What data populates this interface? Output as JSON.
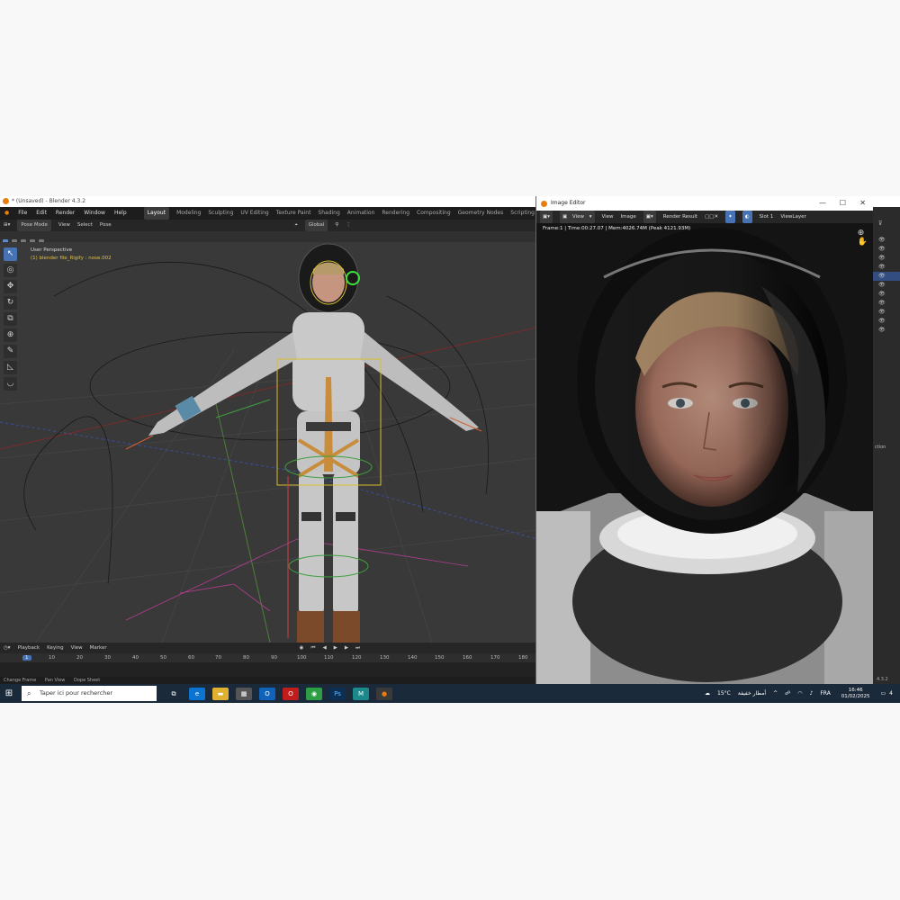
{
  "blender": {
    "title": "* (Unsaved) - Blender 4.3.2",
    "menu": [
      "File",
      "Edit",
      "Render",
      "Window",
      "Help"
    ],
    "workspaces": [
      "Layout",
      "Modeling",
      "Sculpting",
      "UV Editing",
      "Texture Paint",
      "Shading",
      "Animation",
      "Rendering",
      "Compositing",
      "Geometry Nodes",
      "Scripting"
    ],
    "active_workspace": "Layout",
    "header": {
      "mode": "Pose Mode",
      "items": [
        "View",
        "Select",
        "Pose"
      ],
      "orientation": "Global"
    },
    "viewport": {
      "perspective": "User Perspective",
      "active_object": "(1) blender file_Rigify : nose.002"
    },
    "toolbar_icons": [
      "select-box-icon",
      "cursor-icon",
      "move-icon",
      "rotate-icon",
      "scale-icon",
      "transform-icon",
      "annotate-icon",
      "measure-icon",
      "relax-icon"
    ],
    "timeline": {
      "menu": [
        "Playback",
        "Keying",
        "View",
        "Marker"
      ],
      "current_frame": "1",
      "frame_ticks": [
        "10",
        "20",
        "30",
        "40",
        "50",
        "60",
        "70",
        "80",
        "90",
        "100",
        "110",
        "120",
        "130",
        "140",
        "150",
        "160",
        "170",
        "180"
      ]
    },
    "status_bar": [
      "Change Frame",
      "Pan View",
      "Dope Sheet"
    ],
    "version": "4.3.2"
  },
  "image_editor": {
    "title": "Image Editor",
    "header": {
      "view": "View",
      "view2": "View",
      "image": "Image",
      "image_name": "Render Result",
      "slot": "Slot 1",
      "view_layer": "ViewLayer"
    },
    "frame_info": "Frame:1 | Time:00:27.07 | Mem:4026.74M (Peak 4121.93M)",
    "controls": {
      "minimize": "—",
      "maximize": "☐",
      "close": "✕"
    }
  },
  "outliner": {
    "side_text": "ction"
  },
  "taskbar": {
    "search_placeholder": "Taper ici pour rechercher",
    "weather": "15°C",
    "weather_desc": "أمطار خفيفة",
    "language": "FRA",
    "time": "16:46",
    "date": "01/02/2025",
    "notifications": "4"
  },
  "colors": {
    "accent": "#4772b3",
    "blender_orange": "#e87d0d",
    "object_text": "#e0c050"
  }
}
